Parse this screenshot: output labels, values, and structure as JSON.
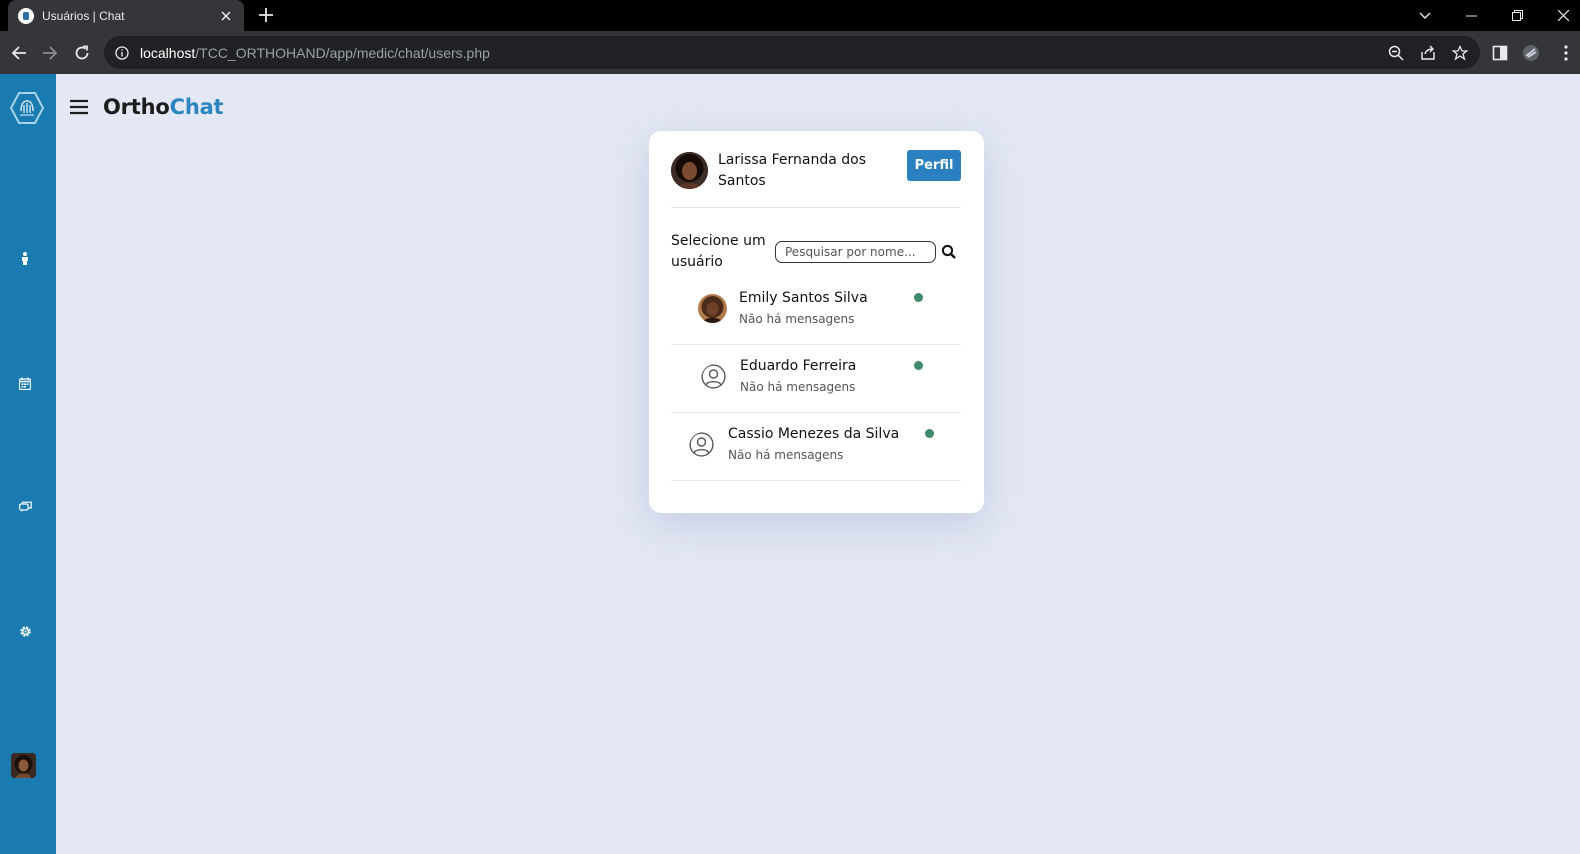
{
  "browser": {
    "tab_title": "Usuários | Chat",
    "url_host": "localhost",
    "url_path": "/TCC_ORTHOHAND/app/medic/chat/users.php"
  },
  "app": {
    "brand_part1": "Ortho",
    "brand_part2": "Chat",
    "accent_color": "#2c85c0",
    "sidebar_color": "#1a7bb0",
    "online_color": "#3f8a68"
  },
  "sidebar": {
    "icons": [
      "hand-logo-icon",
      "person-icon",
      "calendar-icon",
      "chat-icon",
      "gear-icon",
      "user-avatar"
    ]
  },
  "chat": {
    "current_user": "Larissa Fernanda dos Santos",
    "profile_button": "Perfil",
    "select_label": "Selecione um usuário",
    "search_placeholder": "Pesquisar por nome...",
    "users": [
      {
        "name": "Emily Santos Silva",
        "status_message": "Não há mensagens",
        "status": "online",
        "avatar": "photo"
      },
      {
        "name": "Eduardo Ferreira",
        "status_message": "Não há mensagens",
        "status": "online",
        "avatar": "default-user-icon"
      },
      {
        "name": "Cassio Menezes da Silva",
        "status_message": "Não há mensagens",
        "status": "online",
        "avatar": "default-user-icon"
      }
    ]
  }
}
